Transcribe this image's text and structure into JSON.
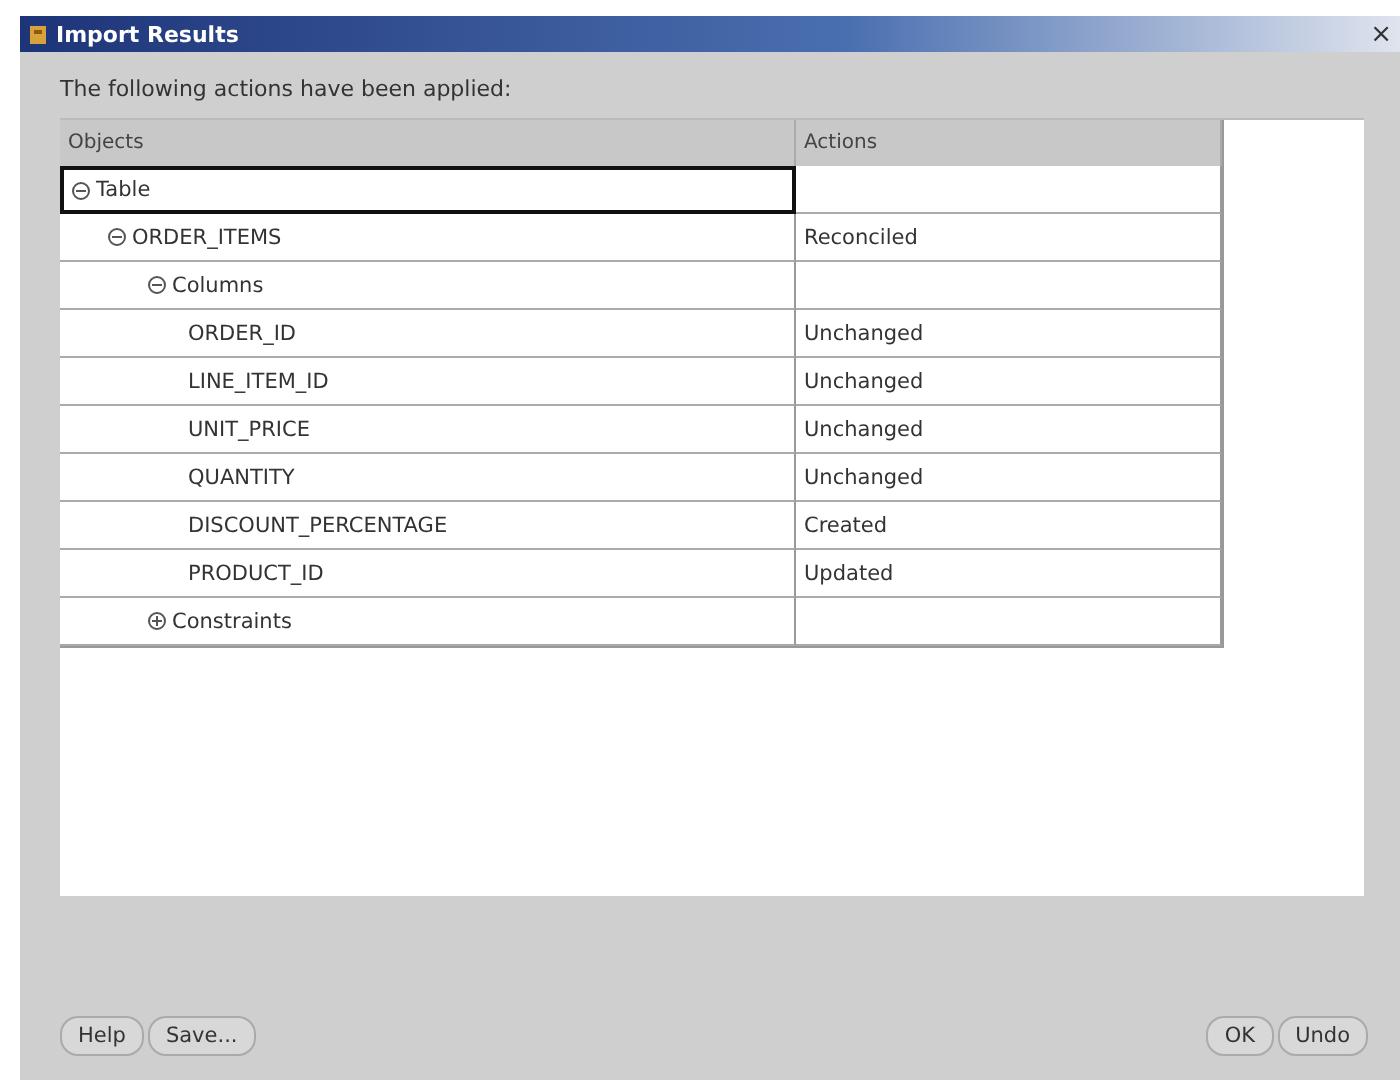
{
  "window": {
    "title": "Import Results",
    "close": "×"
  },
  "message": "The following actions have been applied:",
  "table": {
    "columns": [
      "Objects",
      "Actions"
    ],
    "rows": [
      {
        "label": "Table",
        "expanded": true,
        "selected": true,
        "children": [
          {
            "label": "ORDER_ITEMS",
            "expanded": true,
            "selected": false,
            "action": "Reconciled",
            "children": [
              {
                "label": "Columns",
                "expanded": true,
                "selected": false,
                "children": [
                  {
                    "label": "ORDER_ID",
                    "selected": false,
                    "action": "Unchanged"
                  },
                  {
                    "label": "LINE_ITEM_ID",
                    "selected": false,
                    "action": "Unchanged"
                  },
                  {
                    "label": "UNIT_PRICE",
                    "selected": false,
                    "action": "Unchanged"
                  },
                  {
                    "label": "QUANTITY",
                    "selected": false,
                    "action": "Unchanged"
                  },
                  {
                    "label": "DISCOUNT_PERCENTAGE",
                    "selected": false,
                    "action": "Created"
                  },
                  {
                    "label": "PRODUCT_ID",
                    "selected": false,
                    "action": "Updated"
                  }
                ]
              },
              {
                "label": "Constraints",
                "expanded": false,
                "selected": false
              }
            ]
          }
        ]
      }
    ]
  },
  "buttons_left": [
    "Help",
    "Save..."
  ],
  "buttons_right": [
    "OK",
    "Undo"
  ]
}
